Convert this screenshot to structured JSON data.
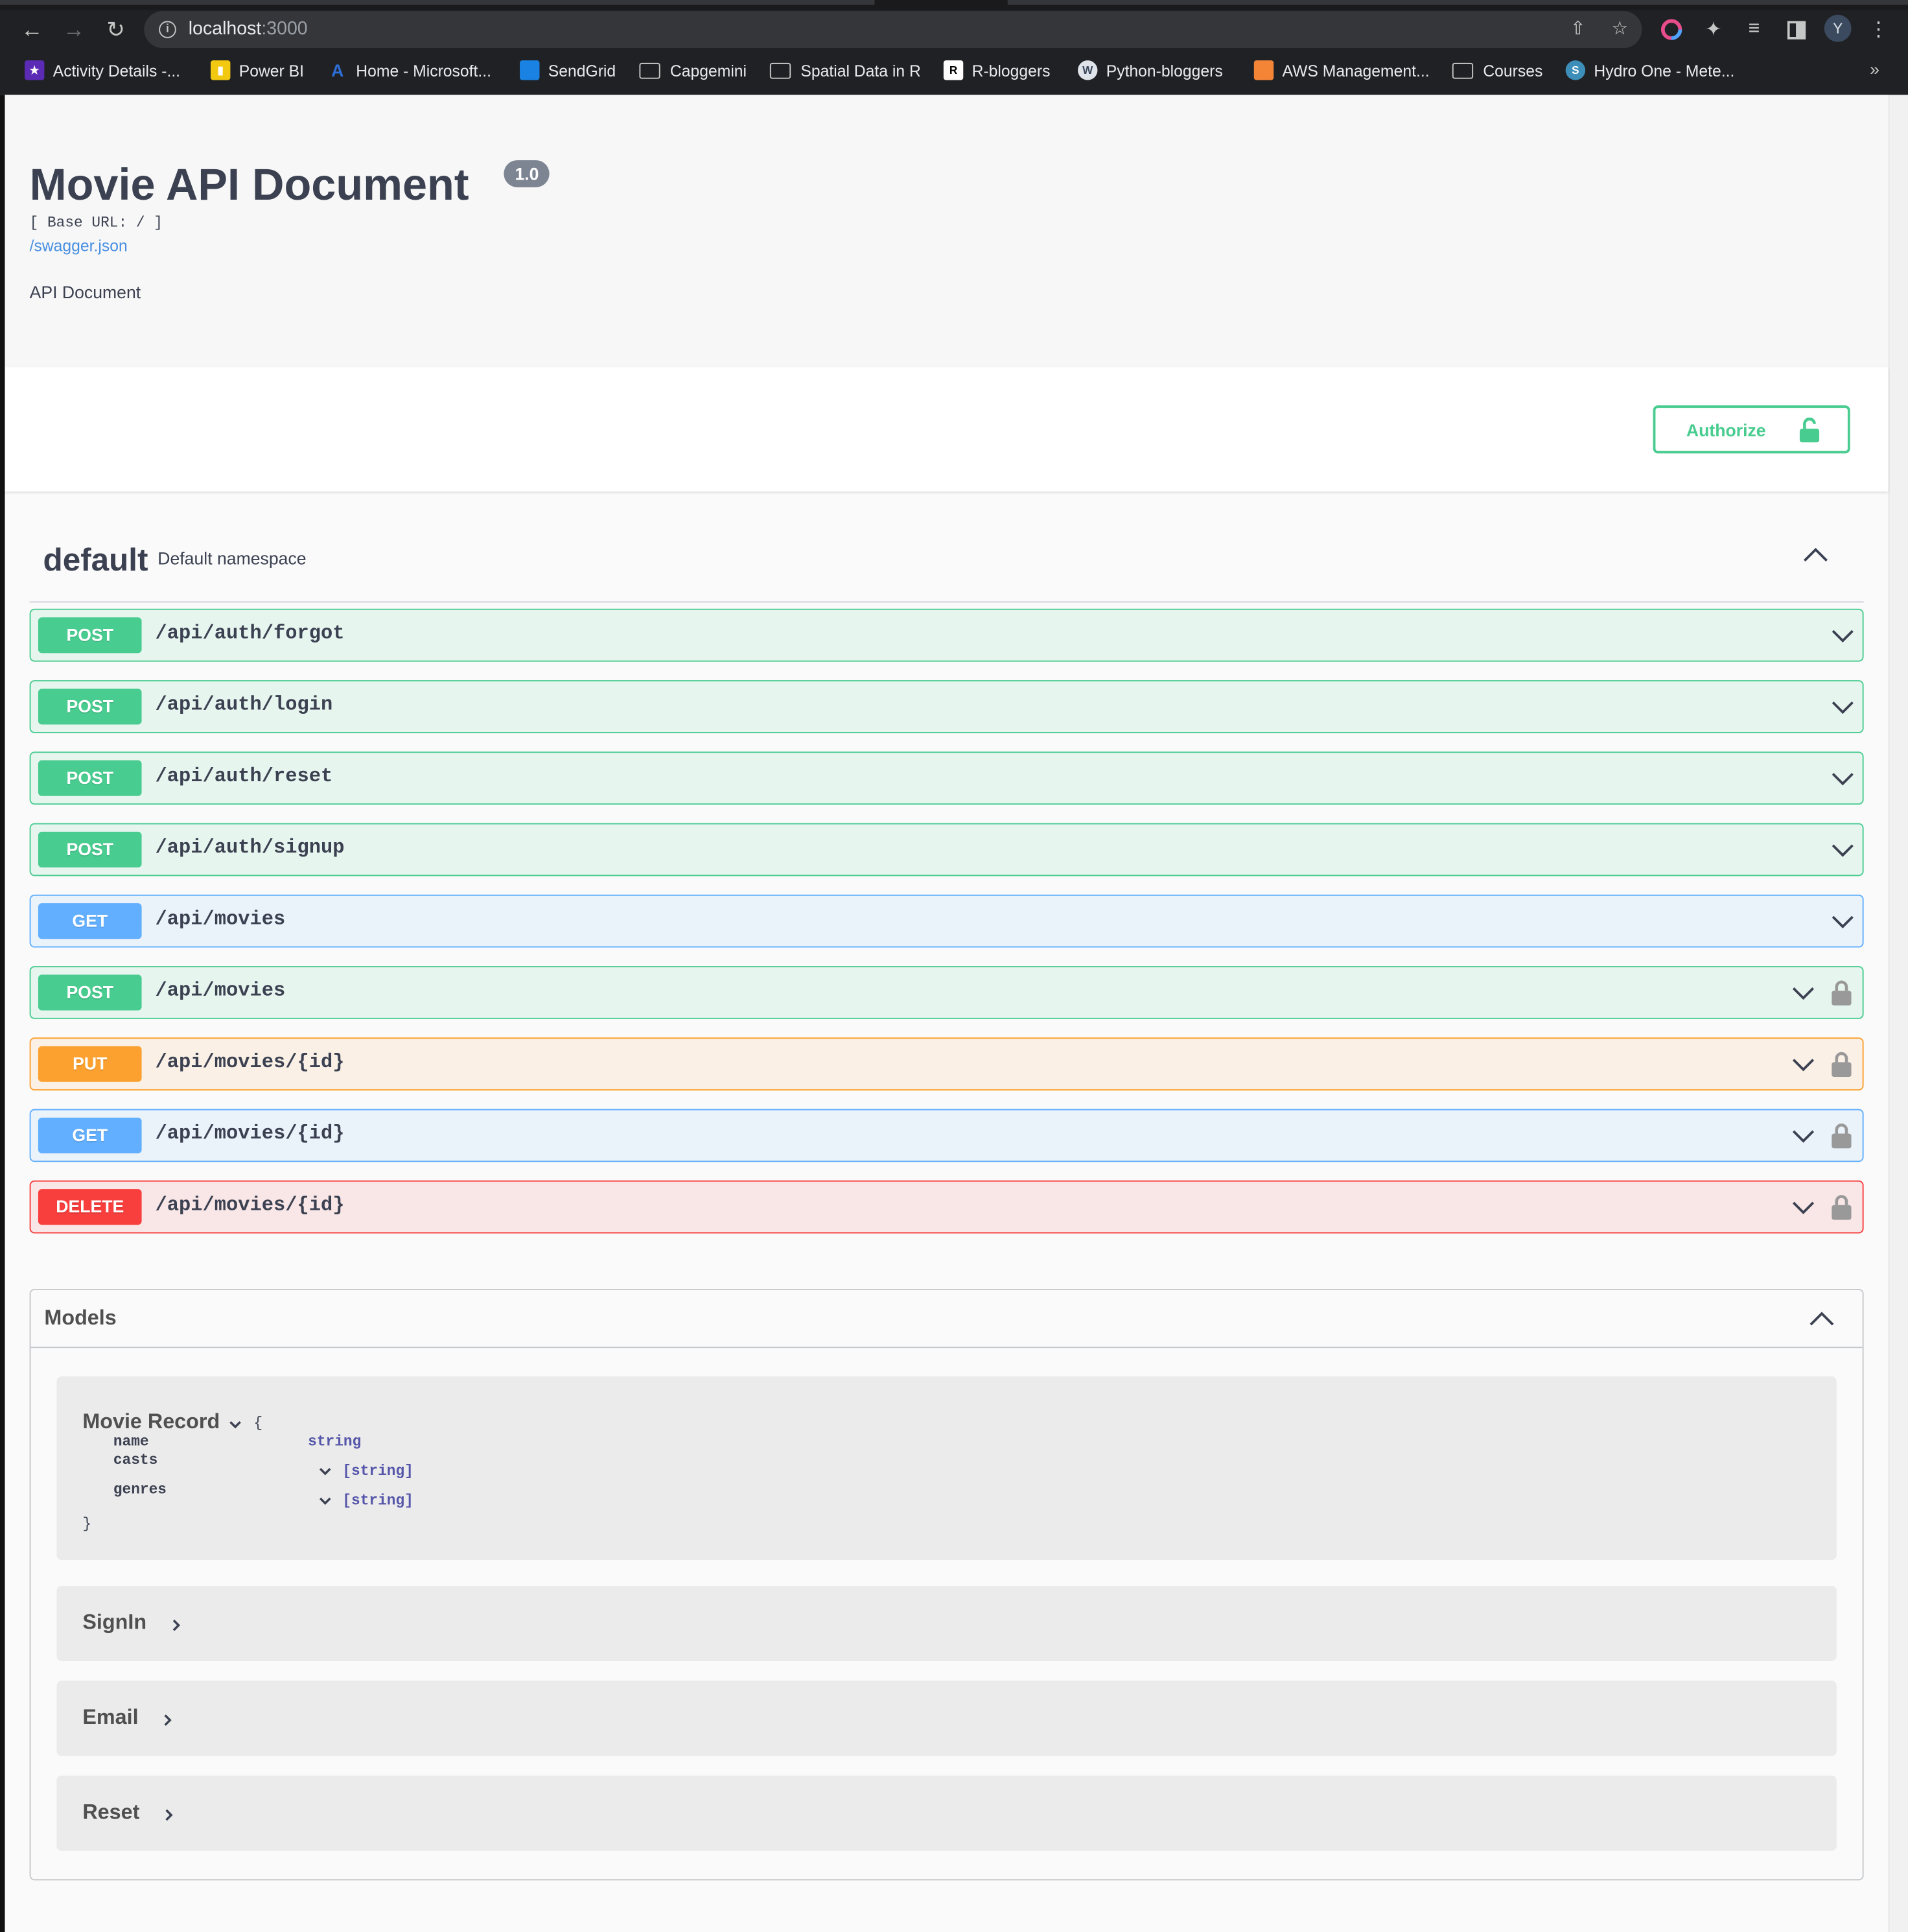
{
  "browser": {
    "url_host": "localhost",
    "url_port": ":3000",
    "bookmarks": [
      {
        "label": "Activity Details -...",
        "color": "#5b2bb5"
      },
      {
        "label": "Power BI",
        "color": "#f2c811"
      },
      {
        "label": "Home - Microsoft...",
        "color": "#2d6fd6"
      },
      {
        "label": "SendGrid",
        "color": "#1a82e2"
      },
      {
        "label": "Capgemini",
        "color": "folder"
      },
      {
        "label": "Spatial Data in R",
        "color": "folder"
      },
      {
        "label": "R-bloggers",
        "color": "#ffffff"
      },
      {
        "label": "Python-bloggers",
        "color": "#dfe3ea"
      },
      {
        "label": "AWS Management...",
        "color": "#f58536"
      },
      {
        "label": "Courses",
        "color": "folder"
      },
      {
        "label": "Hydro One - Mete...",
        "color": "#3d8eb9"
      }
    ],
    "more": "»",
    "avatar_letter": "Y"
  },
  "info": {
    "title": "Movie API Document",
    "version": "1.0",
    "base_url": "[ Base URL: / ]",
    "spec_link": "/swagger.json",
    "description": "API Document"
  },
  "authorize": {
    "label": "Authorize"
  },
  "tag": {
    "name": "default",
    "description": "Default namespace"
  },
  "operations": [
    {
      "method": "POST",
      "path": "/api/auth/forgot",
      "locked": false
    },
    {
      "method": "POST",
      "path": "/api/auth/login",
      "locked": false
    },
    {
      "method": "POST",
      "path": "/api/auth/reset",
      "locked": false
    },
    {
      "method": "POST",
      "path": "/api/auth/signup",
      "locked": false
    },
    {
      "method": "GET",
      "path": "/api/movies",
      "locked": false
    },
    {
      "method": "POST",
      "path": "/api/movies",
      "locked": true
    },
    {
      "method": "PUT",
      "path": "/api/movies/{id}",
      "locked": true
    },
    {
      "method": "GET",
      "path": "/api/movies/{id}",
      "locked": true
    },
    {
      "method": "DELETE",
      "path": "/api/movies/{id}",
      "locked": true
    }
  ],
  "models": {
    "title": "Models",
    "movie_record": {
      "name": "Movie Record",
      "open_brace": "{",
      "close_brace": "}",
      "properties": [
        {
          "name": "name",
          "type": "string"
        },
        {
          "name": "casts",
          "type": "[string]"
        },
        {
          "name": "genres",
          "type": "[string]"
        }
      ]
    },
    "collapsed": [
      "SignIn",
      "Email",
      "Reset"
    ]
  },
  "colors": {
    "post": "#49cc90",
    "get": "#61affe",
    "put": "#fca130",
    "delete": "#f93e3e",
    "text": "#3b4151"
  }
}
